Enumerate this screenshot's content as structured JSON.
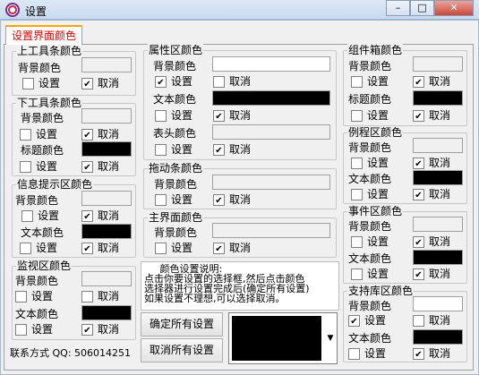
{
  "window": {
    "title": "设置",
    "minimize": "–",
    "maximize": "□",
    "close": "✕"
  },
  "tab": {
    "label": "设置界面颜色"
  },
  "common": {
    "bg": "背景颜色",
    "text": "文本颜色",
    "title": "标题颜色",
    "header": "表头颜色",
    "set": "设置",
    "cancel": "取消"
  },
  "groups": {
    "top_toolbar": "上工具条颜色",
    "bottom_toolbar": "下工具条颜色",
    "info_bar": "信息提示区颜色",
    "monitor": "监视区颜色",
    "property": "属性区颜色",
    "drag_bar": "拖动条颜色",
    "main_view": "主界面颜色",
    "component_box": "组件箱颜色",
    "routine": "例程区颜色",
    "event": "事件区颜色",
    "support_lib": "支持库区颜色"
  },
  "info": {
    "text": "     颜色设置说明:\n点击你要设置的选择框,然后点击颜色\n选择器进行设置完成后(确定所有设置)\n如果设置不理想,可以选择取消。"
  },
  "buttons": {
    "confirm_all": "确定所有设置",
    "cancel_all": "取消所有设置"
  },
  "contact": "联系方式 QQ: 506014251",
  "colors": {
    "title_gradient": "#dce8f6",
    "accent_tab_text": "#d80000",
    "swatch_black": "#000000",
    "panel": "#f0f0f0"
  }
}
